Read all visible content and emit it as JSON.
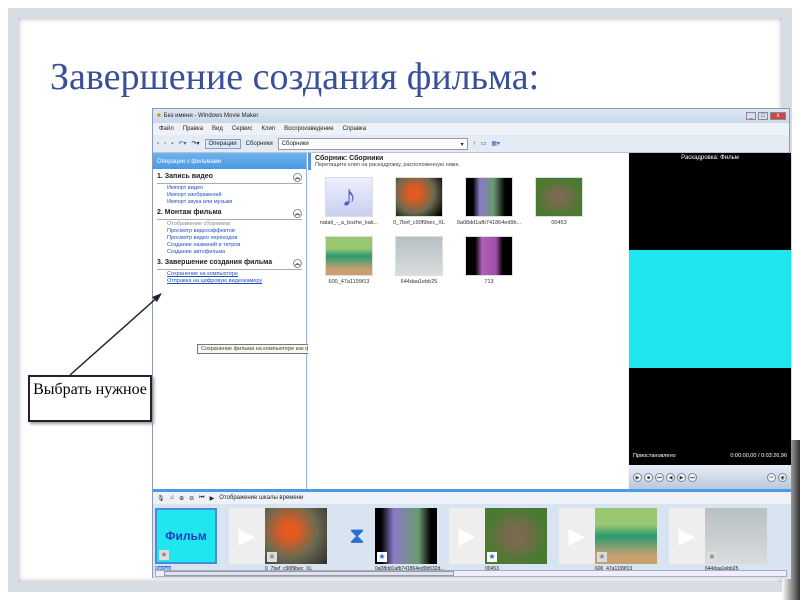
{
  "slide": {
    "title": "Завершение создания фильма:",
    "callout": "Выбрать нужное"
  },
  "window": {
    "title": "Без имени - Windows Movie Maker",
    "menu": [
      "Файл",
      "Правка",
      "Вид",
      "Сервис",
      "Клип",
      "Воспроизведение",
      "Справка"
    ],
    "toolbar": {
      "operations": "Операции",
      "collections": "Сборники",
      "combo": "Сборники"
    },
    "tasks": {
      "header": "Операции с фильмами",
      "sections": [
        {
          "title": "1. Запись видео",
          "links": [
            "Импорт видео",
            "Импорт изображений",
            "Импорт звука или музыки"
          ]
        },
        {
          "title": "2. Монтаж фильма",
          "links": [
            "Отображение сборников",
            "Просмотр видеоэффектов",
            "Просмотр видео переходов",
            "Создание названий и титров",
            "Создание автофильма"
          ]
        },
        {
          "title": "3. Завершение создания фильма",
          "links": [
            "Сохранение на компьютере",
            "Отправка на цифровую видеокамеру"
          ]
        }
      ],
      "tooltip": "Сохранение фильма на компьютере как файла видео."
    },
    "collection": {
      "title": "Сборник: Сборники",
      "hint": "Перетащите клип на раскадровку, расположенную ниже.",
      "items": [
        "natali_-_a_bozhe_kak...",
        "0_7bef_c90f9bec_XL",
        "0a08dd1afb741864ed9b...",
        "00453",
        "600_47a1199f13",
        "644daa1ebb25",
        "713"
      ]
    },
    "preview": {
      "title": "Раскадровка: Фильм",
      "status": "Приостановлено",
      "time": "0:00:00,00 / 0:03:26,96"
    },
    "timeline": {
      "toggle": "Отображение шкалы времени",
      "title_clip": "Фильм",
      "clips": [
        "Фильм",
        "0_7bef_c90f9bec_XL",
        "0a08dd1afb741864ed9b532d...",
        "00453",
        "600_47a1199f13",
        "644daa1ebb25"
      ]
    }
  }
}
